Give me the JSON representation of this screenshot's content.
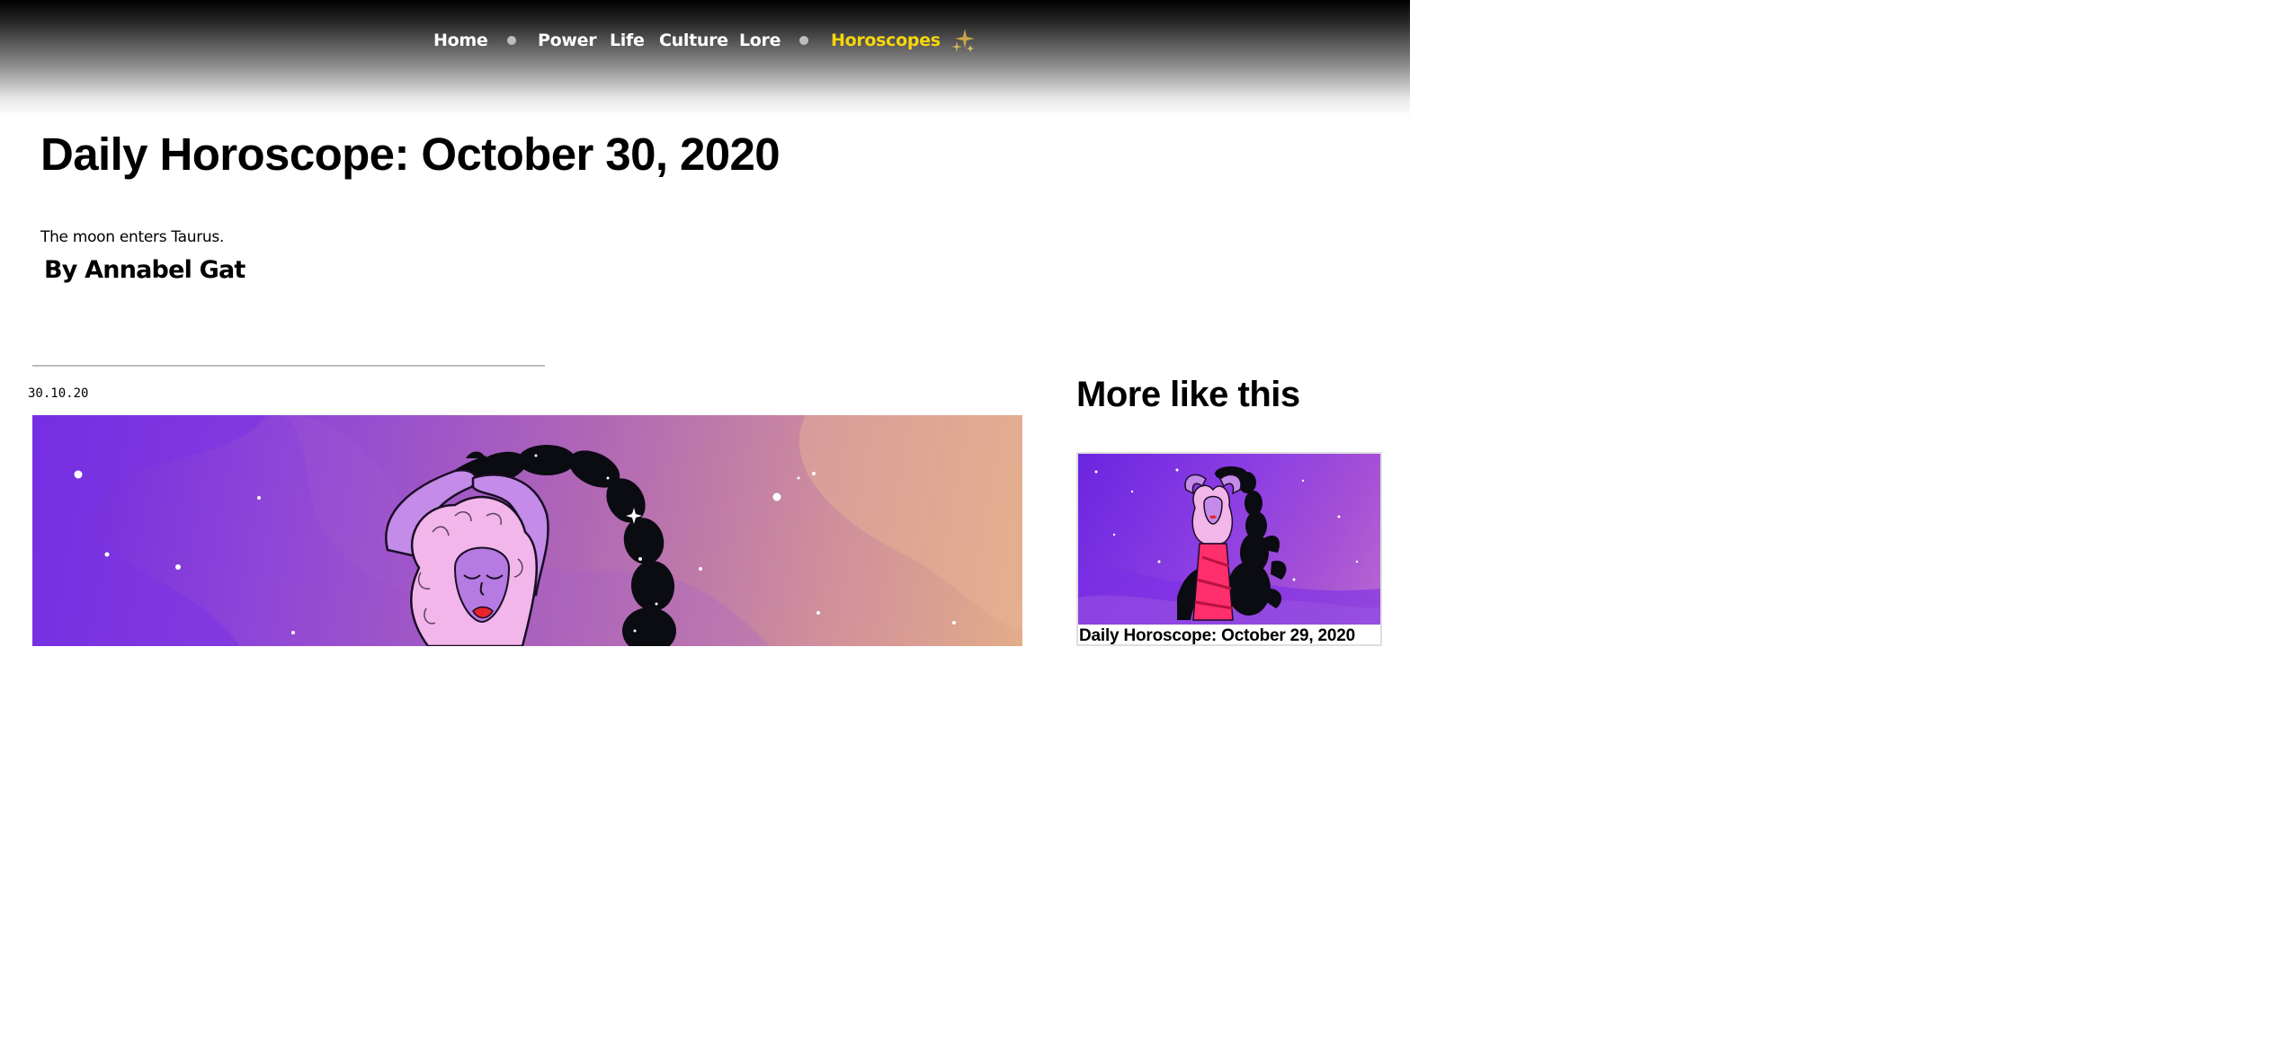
{
  "nav": {
    "items": [
      {
        "label": "Home"
      },
      {
        "label": "Power"
      },
      {
        "label": "Life"
      },
      {
        "label": "Culture"
      },
      {
        "label": "Lore"
      },
      {
        "label": "Horoscopes",
        "active": true
      }
    ],
    "sparkle_icon": "sparkles-icon",
    "active_color": "#f5d60e"
  },
  "article": {
    "title": "Daily Horoscope: October 30, 2020",
    "dek": "The moon enters Taurus.",
    "byline": "By Annabel Gat",
    "date": "30.10.20"
  },
  "sidebar": {
    "heading": "More like this",
    "cards": [
      {
        "title": "Daily Horoscope: October 29, 2020"
      }
    ]
  }
}
